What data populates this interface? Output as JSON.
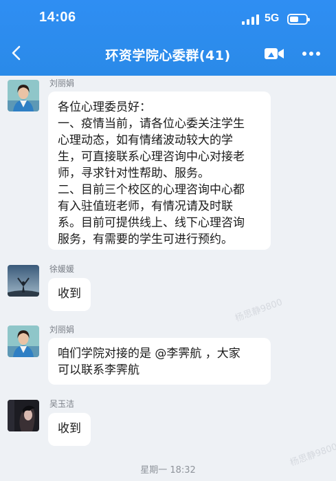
{
  "status_bar": {
    "time": "14:06",
    "network": "5G",
    "battery_level": 0.55
  },
  "header": {
    "title": "环资学院心委群(41)"
  },
  "messages": [
    {
      "sender": "刘丽娟",
      "avatar": "avatar-woman-blue-vest",
      "lines": [
        "各位心理委员好：",
        "一、疫情当前，请各位心委关注学生",
        "心理动态，如有情绪波动较大的学",
        "生，可直接联系心理咨询中心对接老",
        "师，寻求针对性帮助、服务。",
        "二、目前三个校区的心理咨询中心都",
        "有入驻值班老师，有情况请及时联",
        "系。目前可提供线上、线下心理咨询",
        "服务，有需要的学生可进行预约。"
      ]
    },
    {
      "sender": "徐媛媛",
      "avatar": "avatar-sky-arms-raised",
      "lines": [
        "收到"
      ]
    },
    {
      "sender": "刘丽娟",
      "avatar": "avatar-woman-blue-vest",
      "lines": [
        "咱们学院对接的是 @李霁航 ，大家",
        "可以联系李霁航"
      ]
    },
    {
      "sender": "吴玉洁",
      "avatar": "avatar-dark-portrait",
      "lines": [
        "收到"
      ]
    }
  ],
  "time_separator": "星期一 18:32",
  "watermark_text": "杨思静9800",
  "colors": {
    "header": "#2f8ef3",
    "background": "#eef1f5",
    "bubble": "#ffffff"
  }
}
